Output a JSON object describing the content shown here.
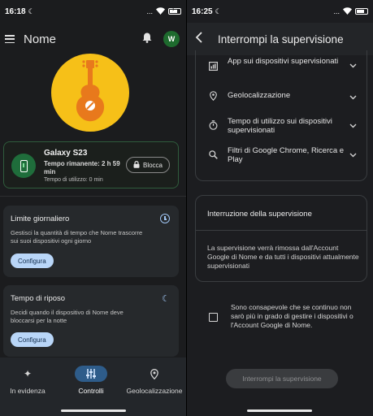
{
  "left": {
    "status": {
      "time": "16:18",
      "dots": "...",
      "wifi": "WiFi",
      "battery_label": ""
    },
    "header": {
      "title": "Nome",
      "avatar_letter": "W"
    },
    "device": {
      "name": "Galaxy S23",
      "remaining": "Tempo rimanente: 2 h 59 min",
      "usage": "Tempo di utilizzo: 0 min",
      "lock_label": "Blocca"
    },
    "cards": [
      {
        "title": "Limite giornaliero",
        "description": "Gestisci la quantità di tempo che Nome trascorre sui suoi dispositivi ogni giorno",
        "button": "Configura",
        "icon": "clock-icon"
      },
      {
        "title": "Tempo di riposo",
        "description": "Decidi quando il dispositivo di Nome deve bloccarsi per la notte",
        "button": "Configura",
        "icon": "moon-icon"
      }
    ],
    "nav": [
      {
        "label": "In evidenza",
        "icon": "sparkle-icon",
        "active": false
      },
      {
        "label": "Controlli",
        "icon": "sliders-icon",
        "active": true
      },
      {
        "label": "Geolocalizzazione",
        "icon": "location-pin-icon",
        "active": false
      }
    ]
  },
  "right": {
    "status": {
      "time": "16:25",
      "dots": "..."
    },
    "header": {
      "title": "Interrompi la supervisione"
    },
    "permissions": [
      {
        "label": "App sui dispositivi supervisionati",
        "icon": "app-grid-icon"
      },
      {
        "label": "Geolocalizzazione",
        "icon": "location-pin-icon"
      },
      {
        "label": "Tempo di utilizzo sui dispositivi supervisionati",
        "icon": "timer-icon"
      },
      {
        "label": "Filtri di Google Chrome, Ricerca e Play",
        "icon": "search-icon"
      }
    ],
    "stop_section": {
      "heading": "Interruzione della supervisione",
      "description": "La supervisione verrà rimossa dall'Account Google di Nome e da tutti i dispositivi attualmente supervisionati"
    },
    "acknowledge": "Sono consapevole che se continuo non sarò più in grado di gestire i dispositivi o l'Account Google di Nome.",
    "stop_button": "Interrompi la supervisione"
  },
  "colors": {
    "background": "#1b1c1e",
    "hero": "#f6c018",
    "device_border": "#2f5c3c",
    "button_blue": "#b9d6f8",
    "nav_active": "#2e5c8a",
    "avatar": "#1e6b2e"
  }
}
